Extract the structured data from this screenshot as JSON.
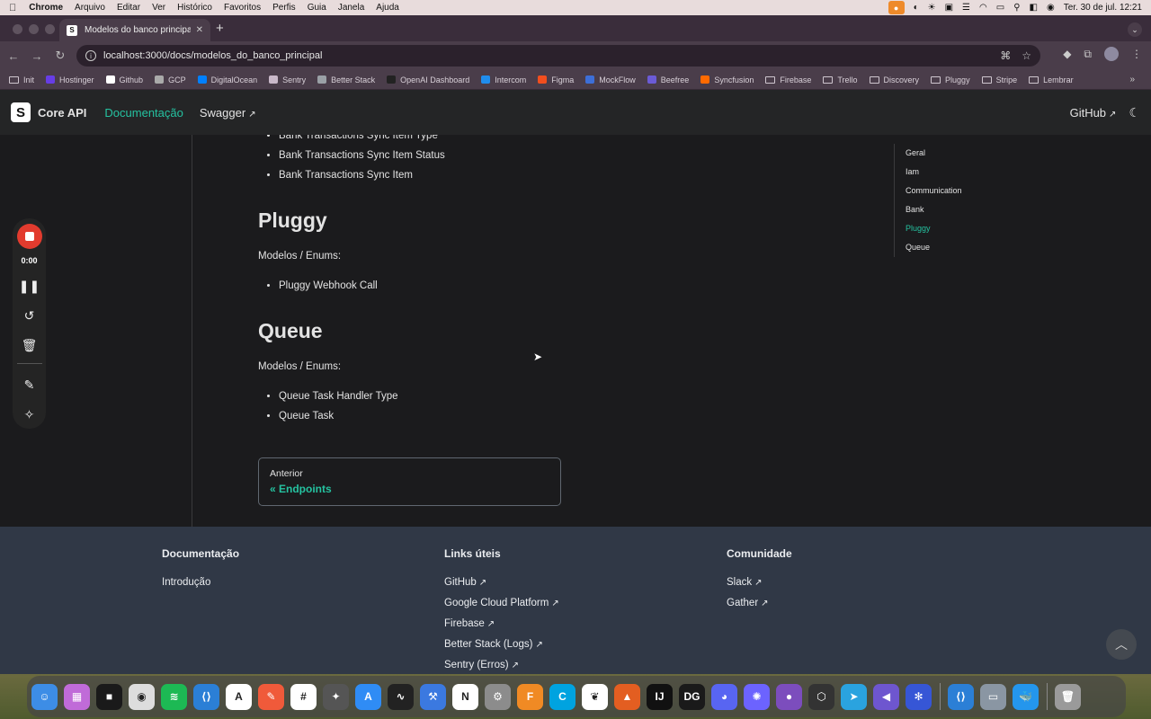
{
  "menubar": {
    "app": "Chrome",
    "items": [
      "Arquivo",
      "Editar",
      "Ver",
      "Histórico",
      "Favoritos",
      "Perfis",
      "Guia",
      "Janela",
      "Ajuda"
    ],
    "datetime": "Ter. 30 de jul.  12:21"
  },
  "browser": {
    "tab_title": "Modelos do banco principal |",
    "url": "localhost:3000/docs/modelos_do_banco_principal",
    "bookmarks": [
      {
        "label": "Init",
        "kind": "folder"
      },
      {
        "label": "Hostinger",
        "kind": "site",
        "color": "#673de6"
      },
      {
        "label": "Github",
        "kind": "site",
        "color": "#ffffff"
      },
      {
        "label": "GCP",
        "kind": "site",
        "color": "#aaaaaa"
      },
      {
        "label": "DigitalOcean",
        "kind": "site",
        "color": "#0080ff"
      },
      {
        "label": "Sentry",
        "kind": "site",
        "color": "#c9b8c9"
      },
      {
        "label": "Better Stack",
        "kind": "site",
        "color": "#9aa0a6"
      },
      {
        "label": "OpenAI Dashboard",
        "kind": "site",
        "color": "#222222"
      },
      {
        "label": "Intercom",
        "kind": "site",
        "color": "#1f8ded"
      },
      {
        "label": "Figma",
        "kind": "site",
        "color": "#f24e1e"
      },
      {
        "label": "MockFlow",
        "kind": "site",
        "color": "#3d6fd8"
      },
      {
        "label": "Beefree",
        "kind": "site",
        "color": "#6b5bd6"
      },
      {
        "label": "Syncfusion",
        "kind": "site",
        "color": "#ff6a00"
      },
      {
        "label": "Firebase",
        "kind": "folder"
      },
      {
        "label": "Trello",
        "kind": "folder"
      },
      {
        "label": "Discovery",
        "kind": "folder"
      },
      {
        "label": "Pluggy",
        "kind": "folder"
      },
      {
        "label": "Stripe",
        "kind": "folder"
      },
      {
        "label": "Lembrar",
        "kind": "folder"
      }
    ]
  },
  "docnav": {
    "brand": "Core API",
    "links": [
      "Documentação",
      "Swagger"
    ],
    "github": "GitHub"
  },
  "content": {
    "list_top": [
      "Bank Transactions Sync Item Type",
      "Bank Transactions Sync Item Status",
      "Bank Transactions Sync Item"
    ],
    "sections": [
      {
        "title": "Pluggy",
        "intro": "Modelos / Enums:",
        "items": [
          "Pluggy Webhook Call"
        ]
      },
      {
        "title": "Queue",
        "intro": "Modelos / Enums:",
        "items": [
          "Queue Task Handler Type",
          "Queue Task"
        ]
      }
    ],
    "pager": {
      "sublabel": "Anterior",
      "label": "« Endpoints"
    }
  },
  "toc": {
    "items": [
      "Geral",
      "Iam",
      "Communication",
      "Bank",
      "Pluggy",
      "Queue"
    ],
    "active": "Pluggy"
  },
  "recorder": {
    "time": "0:00"
  },
  "footer": {
    "columns": [
      {
        "title": "Documentação",
        "links": [
          "Introdução"
        ]
      },
      {
        "title": "Links úteis",
        "links": [
          "GitHub",
          "Google Cloud Platform",
          "Firebase",
          "Better Stack (Logs)",
          "Sentry (Erros)"
        ]
      },
      {
        "title": "Comunidade",
        "links": [
          "Slack",
          "Gather"
        ]
      }
    ]
  },
  "dock": {
    "apps": [
      {
        "name": "finder",
        "color": "#3d8de6",
        "glyph": "☺"
      },
      {
        "name": "launchpad",
        "color": "#c06bd8",
        "glyph": "▦"
      },
      {
        "name": "app-3",
        "color": "#1a1a1a",
        "glyph": "■"
      },
      {
        "name": "chrome",
        "color": "#dddddd",
        "glyph": "◉"
      },
      {
        "name": "spotify",
        "color": "#1db954",
        "glyph": "≋"
      },
      {
        "name": "vscode",
        "color": "#2b7fd6",
        "glyph": "⟨⟩"
      },
      {
        "name": "app-7",
        "color": "#ffffff",
        "glyph": "A"
      },
      {
        "name": "app-8",
        "color": "#f05a3a",
        "glyph": "✎"
      },
      {
        "name": "slack",
        "color": "#ffffff",
        "glyph": "#"
      },
      {
        "name": "app-10",
        "color": "#555555",
        "glyph": "✦"
      },
      {
        "name": "app-store",
        "color": "#2f8cf5",
        "glyph": "A"
      },
      {
        "name": "activity-monitor",
        "color": "#222222",
        "glyph": "∿"
      },
      {
        "name": "xcode",
        "color": "#3b79e0",
        "glyph": "⚒"
      },
      {
        "name": "notion",
        "color": "#ffffff",
        "glyph": "N"
      },
      {
        "name": "settings",
        "color": "#8c8c8c",
        "glyph": "⚙"
      },
      {
        "name": "fusion",
        "color": "#f08a24",
        "glyph": "F"
      },
      {
        "name": "app-17",
        "color": "#00a3e0",
        "glyph": "C"
      },
      {
        "name": "mongodb",
        "color": "#ffffff",
        "glyph": "❦"
      },
      {
        "name": "matlab",
        "color": "#e35e21",
        "glyph": "▲"
      },
      {
        "name": "intellij",
        "color": "#111111",
        "glyph": "IJ"
      },
      {
        "name": "datagrip",
        "color": "#1a1a1a",
        "glyph": "DG"
      },
      {
        "name": "discord",
        "color": "#5865f2",
        "glyph": "◕"
      },
      {
        "name": "app-23",
        "color": "#6c63ff",
        "glyph": "✺"
      },
      {
        "name": "app-24",
        "color": "#7c4dbd",
        "glyph": "●"
      },
      {
        "name": "unity",
        "color": "#333333",
        "glyph": "⬡"
      },
      {
        "name": "telegram",
        "color": "#2aa3df",
        "glyph": "➤"
      },
      {
        "name": "app-27",
        "color": "#6e56cf",
        "glyph": "◀"
      },
      {
        "name": "app-28",
        "color": "#3656d6",
        "glyph": "✻"
      },
      {
        "name": "vscode-2",
        "color": "#2b7fd6",
        "glyph": "⟨⟩"
      },
      {
        "name": "app-30",
        "color": "#8a96a3",
        "glyph": "▭"
      },
      {
        "name": "docker",
        "color": "#2496ed",
        "glyph": "🐳"
      },
      {
        "name": "trash",
        "color": "#9a9a9a",
        "glyph": "🗑"
      }
    ]
  }
}
